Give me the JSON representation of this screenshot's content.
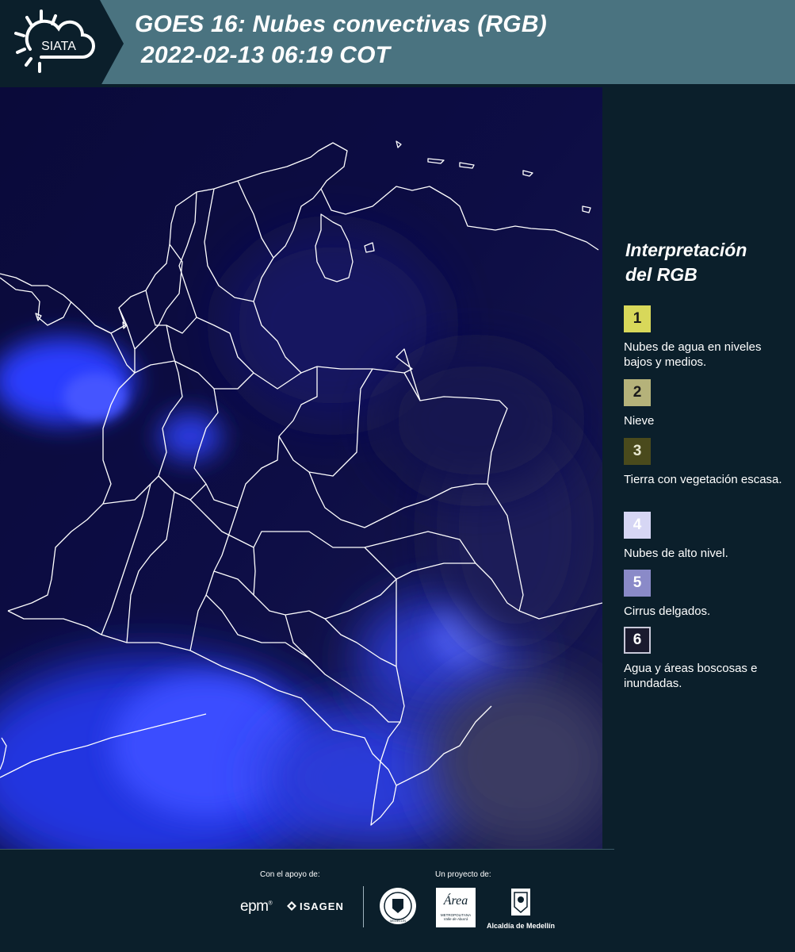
{
  "header": {
    "logo_text": "SIATA",
    "title_line1": "GOES 16: Nubes convectivas (RGB)",
    "title_line2": "2022-02-13 06:19 COT",
    "background_color": "#4a7380"
  },
  "map": {
    "icon": "satellite-map",
    "land_color": "#0c0c3a",
    "cloud_color": "#2a3cff",
    "border_color": "#ffffff"
  },
  "legend": {
    "title_line1": "Interpretación",
    "title_line2": "del RGB",
    "items": [
      {
        "number": "1",
        "color": "#d8d85a",
        "label": "Nubes de agua en niveles bajos y medios."
      },
      {
        "number": "2",
        "color": "#b5b27a",
        "label": "Nieve"
      },
      {
        "number": "3",
        "color": "#4a4a1c",
        "label": "Tierra con vegetación escasa."
      },
      {
        "number": "4",
        "color": "#d6d6f4",
        "label": "Nubes de alto nivel."
      },
      {
        "number": "5",
        "color": "#8a8ac8",
        "label": "Cirrus delgados."
      },
      {
        "number": "6",
        "color": "#1a1a2e",
        "label": "Agua y áreas boscosas e inundadas."
      }
    ]
  },
  "footer": {
    "support_label": "Con el apoyo de:",
    "project_label": "Un proyecto de:",
    "epm_logo": "epm",
    "isagen_logo": "ISAGEN",
    "area_logo": "Área",
    "area_sub": "METROPOLITANA",
    "area_sub2": "Valle de Aburrá",
    "alcaldia_logo": "Alcaldía de Medellín",
    "medellin_seal_text": "MEDELLÍN"
  }
}
